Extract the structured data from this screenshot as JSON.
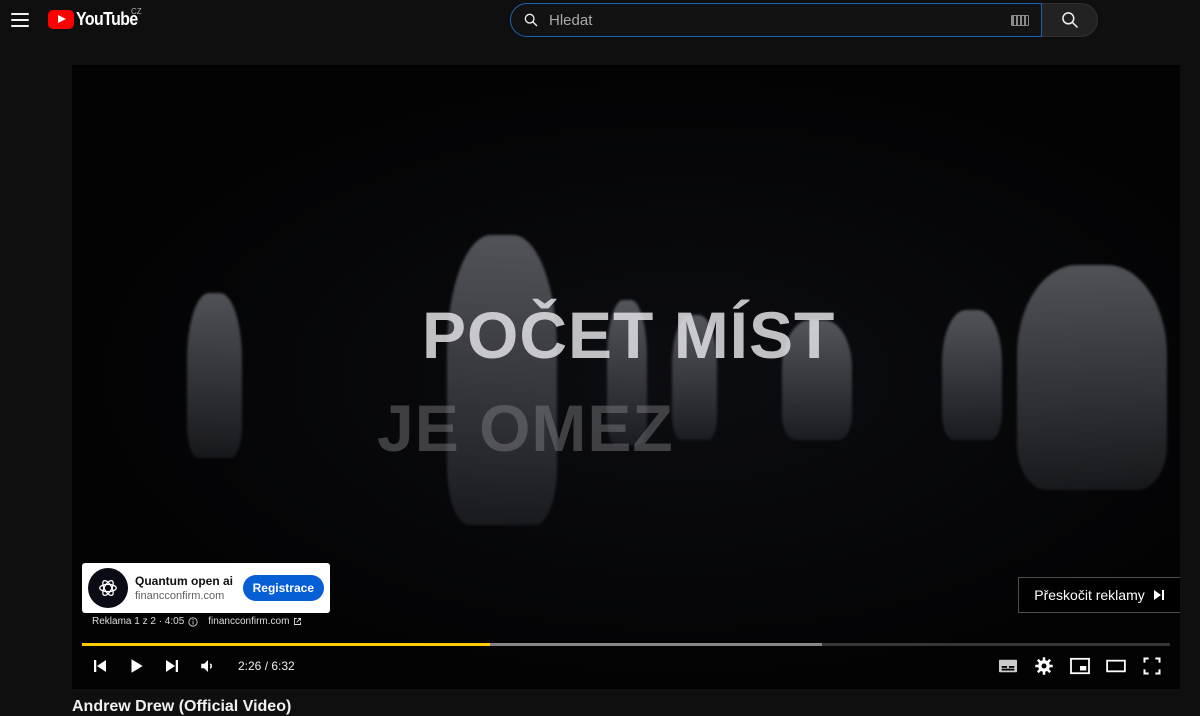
{
  "header": {
    "logo_text": "YouTube",
    "country": "CZ",
    "search_placeholder": "Hledat"
  },
  "video": {
    "overlay_line1": "POČET MÍST",
    "overlay_line2": "JE OMEZ",
    "title_below": "Andrew Drew (Official Video)"
  },
  "ad": {
    "title": "Quantum open ai",
    "url": "financconfirm.com",
    "cta": "Registrace",
    "info": "Reklama 1 z 2 · 4:05",
    "info_url": "financconfirm.com",
    "skip_label": "Přeskočit reklamy"
  },
  "player": {
    "time": "2:26 / 6:32",
    "played_fraction": 0.375,
    "loaded_fraction": 0.68,
    "progress_color": "#ffcc00"
  }
}
